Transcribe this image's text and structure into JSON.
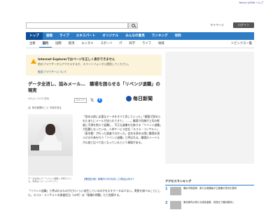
{
  "topbar": {
    "links": "Yahoo! JAPAN  ヘルプ"
  },
  "search": {
    "placeholder": "",
    "mypage_label": "マイページ",
    "login_label": "ログイン"
  },
  "main_nav": [
    {
      "label": "トップ",
      "active": true
    },
    {
      "label": "速報",
      "active": false
    },
    {
      "label": "ライブ",
      "active": false
    },
    {
      "label": "エキスパート",
      "active": false
    },
    {
      "label": "オリジナル",
      "active": false
    },
    {
      "label": "みんなの意見",
      "active": false
    },
    {
      "label": "ランキング",
      "active": false
    },
    {
      "label": "有料",
      "active": false
    }
  ],
  "sub_nav": {
    "items": [
      {
        "label": "主要",
        "selected": false
      },
      {
        "label": "国内",
        "selected": true
      },
      {
        "label": "国際",
        "selected": false
      },
      {
        "label": "経済",
        "selected": false
      },
      {
        "label": "エンタメ",
        "selected": false
      },
      {
        "label": "スポーツ",
        "selected": false
      },
      {
        "label": "IT",
        "selected": false
      },
      {
        "label": "科学",
        "selected": false
      },
      {
        "label": "ライフ",
        "selected": false
      },
      {
        "label": "地域",
        "selected": false
      }
    ],
    "right_label": "トピックス一覧"
  },
  "warning": {
    "title": "Internet Explorerではページを正しく表示できません",
    "line1": "他のブラウザーからアクセスするか、スマートフォンから閲覧してください。",
    "line2": "",
    "link": "推奨ブラウザーについて"
  },
  "article": {
    "headline": "データ全消し、詰みメール…　職場を困らせる「リベンジ退職」の現実",
    "date": "5/6(火) 10:00 配信",
    "comments_label": "コメント",
    "author_line": "毎日新聞のこと 写真を見る",
    "publisher_logo": "毎日新聞",
    "caption": "データ全消しや「リベンジ退職」が増えている。写真はイメージ＝ゲッティ",
    "body": "「辞める前に必要なデータをすべて消していった」「顧客が辞められたあとにメールが送られてきて」……。職場で同僚が上司の態度に不満を抱えて退職し、不正な退職を仕掛ける「リベンジ退職」が話題になっている。人材サービス会社「スコラ・コンサルト」（東京都）が行った調査で分かった。会社を辞める際に職場を困らせる行為を行う「リベンジ退職」と呼ばれる。職場のハードルが以前と比べて低くなっているという事情がある。",
    "related": "【関連記事】退職代行を利用した理由は何か？",
    "para2": "「リベンジ退職」と呼ばれるものがどれくらい発生しているのかを示すデータは少ない。実態を調べることにした。スコラ・コンサルトの調査担当（26代）は「組織の問題」だと指摘する。"
  },
  "ranking": {
    "title": "アクセスランキング",
    "items": [
      {
        "rank": "1",
        "text": "横浜市長選挙、新たな候補者が立候補の意向を表明"
      },
      {
        "rank": "2",
        "text": "東京都内の新たな感染者数、前週比で増加傾向に"
      }
    ]
  }
}
